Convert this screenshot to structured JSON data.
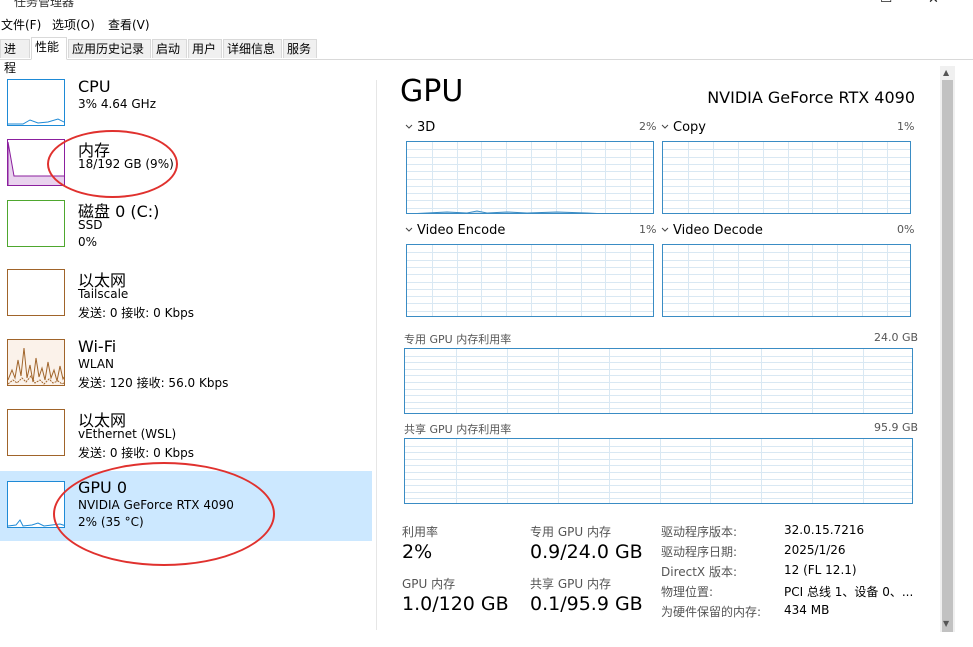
{
  "window": {
    "title": "任务管理器"
  },
  "menu": [
    "文件(F)",
    "选项(O)",
    "查看(V)"
  ],
  "tabs": [
    "进程",
    "性能",
    "应用历史记录",
    "启动",
    "用户",
    "详细信息",
    "服务"
  ],
  "active_tab": "性能",
  "sidebar": {
    "items": [
      {
        "name": "CPU",
        "line1": "3% 4.64 GHz",
        "line2": "",
        "color": "#1e8ad6"
      },
      {
        "name": "内存",
        "line1": "18/192 GB (9%)",
        "line2": "",
        "color": "#8b1f9e"
      },
      {
        "name": "磁盘 0 (C:)",
        "line1": "SSD",
        "line2": "0%",
        "color": "#4ea72e"
      },
      {
        "name": "以太网",
        "line1": "Tailscale",
        "line2": "发送: 0 接收: 0 Kbps",
        "color": "#a0642a"
      },
      {
        "name": "Wi-Fi",
        "line1": "WLAN",
        "line2": "发送: 120 接收: 56.0 Kbps",
        "color": "#a0642a"
      },
      {
        "name": "以太网",
        "line1": "vEthernet (WSL)",
        "line2": "发送: 0 接收: 0 Kbps",
        "color": "#a0642a"
      },
      {
        "name": "GPU 0",
        "line1": "NVIDIA GeForce RTX 4090",
        "line2": "2% (35 °C)",
        "color": "#1e8ad6"
      }
    ]
  },
  "gpu": {
    "title": "GPU",
    "model": "NVIDIA GeForce RTX 4090",
    "engines": [
      {
        "name": "3D",
        "pct": "2%"
      },
      {
        "name": "Copy",
        "pct": "1%"
      },
      {
        "name": "Video Encode",
        "pct": "1%"
      },
      {
        "name": "Video Decode",
        "pct": "0%"
      }
    ],
    "dedicated_label": "专用 GPU 内存利用率",
    "dedicated_max": "24.0 GB",
    "shared_label": "共享 GPU 内存利用率",
    "shared_max": "95.9 GB",
    "stats": {
      "util_label": "利用率",
      "util_value": "2%",
      "ded_label": "专用 GPU 内存",
      "ded_value": "0.9/24.0 GB",
      "gpumem_label": "GPU 内存",
      "gpumem_value": "1.0/120 GB",
      "shr_label": "共享 GPU 内存",
      "shr_value": "0.1/95.9 GB"
    },
    "details": [
      {
        "k": "驱动程序版本:",
        "v": "32.0.15.7216"
      },
      {
        "k": "驱动程序日期:",
        "v": "2025/1/26"
      },
      {
        "k": "DirectX 版本:",
        "v": "12 (FL 12.1)"
      },
      {
        "k": "物理位置:",
        "v": "PCI 总线 1、设备 0、..."
      },
      {
        "k": "为硬件保留的内存:",
        "v": "434 MB"
      }
    ]
  },
  "colors": {
    "accent": "#3a8cc4",
    "selected_bg": "#cce8ff",
    "annotation": "#e0312e"
  }
}
